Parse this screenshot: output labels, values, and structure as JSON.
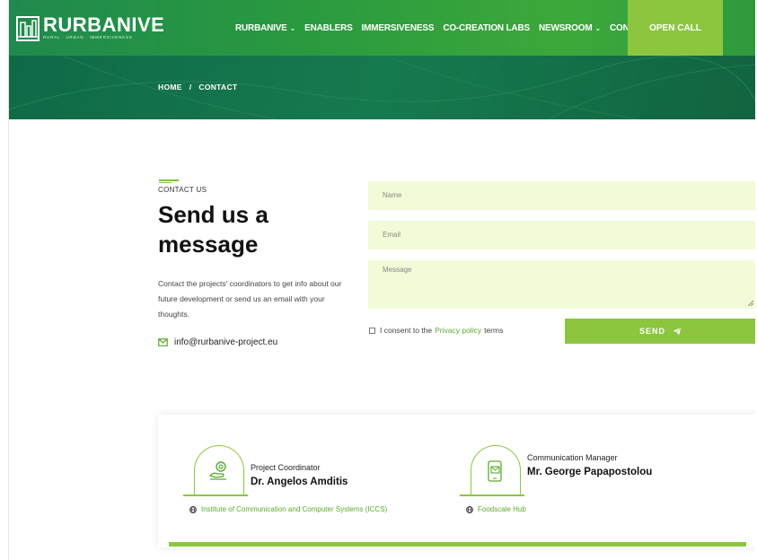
{
  "header": {
    "logo_text": "RURBANIVE",
    "logo_tagline": "RURAL · URBAN · IMMERSIVENESS",
    "nav": [
      {
        "label": "RURBANIVE",
        "has_dropdown": true
      },
      {
        "label": "ENABLERS",
        "has_dropdown": false
      },
      {
        "label": "IMMERSIVENESS",
        "has_dropdown": false
      },
      {
        "label": "CO-CREATION LABS",
        "has_dropdown": false
      },
      {
        "label": "NEWSROOM",
        "has_dropdown": true
      },
      {
        "label": "CONTACT",
        "has_dropdown": false
      }
    ],
    "cta": "OPEN CALL"
  },
  "breadcrumb": {
    "home": "HOME",
    "separator": "/",
    "current": "CONTACT"
  },
  "contact": {
    "eyebrow": "CONTACT US",
    "heading": "Send us a message",
    "description": "Contact the projects' coordinators to get info about our future development or send us an email with your thoughts.",
    "email": "info@rurbanive-project.eu"
  },
  "form": {
    "name_placeholder": "Name",
    "email_placeholder": "Email",
    "message_placeholder": "Message",
    "consent_prefix": "I consent to the",
    "consent_link": "Privacy policy",
    "consent_suffix": "terms",
    "send_label": "SEND"
  },
  "team": [
    {
      "role": "Project Coordinator",
      "name": "Dr. Angelos Amditis",
      "org": "Institute of Communication and Computer Systems (ICCS)",
      "icon": "handshake-gear-icon"
    },
    {
      "role": "Communication Manager",
      "name": "Mr. George Papapostolou",
      "org": "Foodscale Hub",
      "icon": "phone-mail-icon"
    }
  ],
  "colors": {
    "brand_green": "#2a9a3f",
    "accent_lime": "#8cc63f",
    "band_dark": "#0f6a47",
    "field_bg": "#f2fbd8",
    "link_green": "#5aaa2e"
  }
}
